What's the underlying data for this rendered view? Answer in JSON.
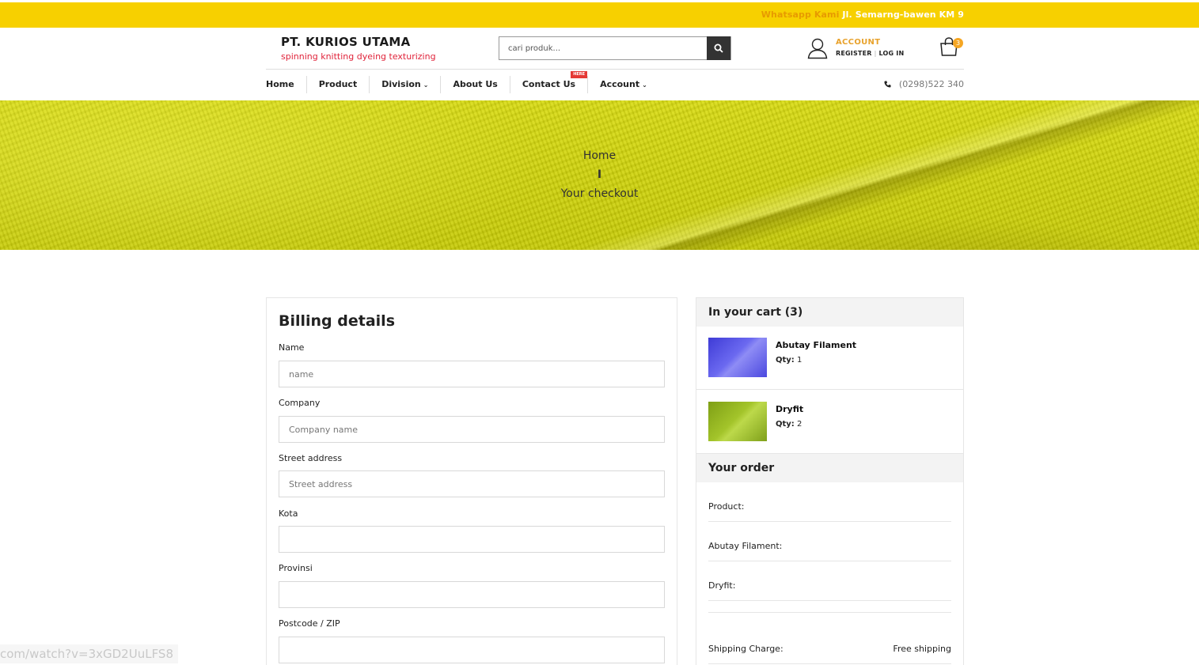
{
  "topbar": {
    "label": "Whatsapp Kami",
    "address": "Jl. Semarng-bawen KM 9"
  },
  "brand": {
    "name": "PT. KURIOS UTAMA",
    "tagline": "spinning knitting dyeing texturizing"
  },
  "search": {
    "placeholder": "cari produk...",
    "icon": "search-icon"
  },
  "account": {
    "title": "ACCOUNT",
    "register": "REGISTER",
    "login": "LOG IN"
  },
  "cart": {
    "count": "3"
  },
  "nav": {
    "items": [
      {
        "label": "Home"
      },
      {
        "label": "Product"
      },
      {
        "label": "Division"
      },
      {
        "label": "About Us"
      },
      {
        "label": "Contact Us",
        "badge": "HERE"
      },
      {
        "label": "Account"
      }
    ],
    "phone": "(0298)522 340"
  },
  "breadcrumb": {
    "home": "Home",
    "separator": "I",
    "current": "Your checkout"
  },
  "billing": {
    "title": "Billing details",
    "fields": [
      {
        "label": "Name",
        "placeholder": "name"
      },
      {
        "label": "Company",
        "placeholder": "Company name"
      },
      {
        "label": "Street address",
        "placeholder": "Street address"
      },
      {
        "label": "Kota",
        "placeholder": ""
      },
      {
        "label": "Provinsi",
        "placeholder": ""
      },
      {
        "label": "Postcode / ZIP",
        "placeholder": ""
      }
    ]
  },
  "cart_panel": {
    "title": "In your cart (3)",
    "items": [
      {
        "name": "Abutay Filament",
        "qty_label": "Qty:",
        "qty": "1"
      },
      {
        "name": "Dryfit",
        "qty_label": "Qty:",
        "qty": "2"
      }
    ]
  },
  "order": {
    "title": "Your order",
    "rows": [
      {
        "label": "Product:",
        "value": ""
      },
      {
        "label": "Abutay Filament:",
        "value": ""
      },
      {
        "label": "Dryfit:",
        "value": ""
      },
      {
        "label": "",
        "value": ""
      },
      {
        "label": "Shipping Charge:",
        "value": "Free shipping"
      }
    ]
  },
  "status_url": "com/watch?v=3xGD2UuLFS8",
  "colors": {
    "topbar": "#f7d000",
    "accent": "#e8a22c",
    "tagline": "#e0233a"
  }
}
